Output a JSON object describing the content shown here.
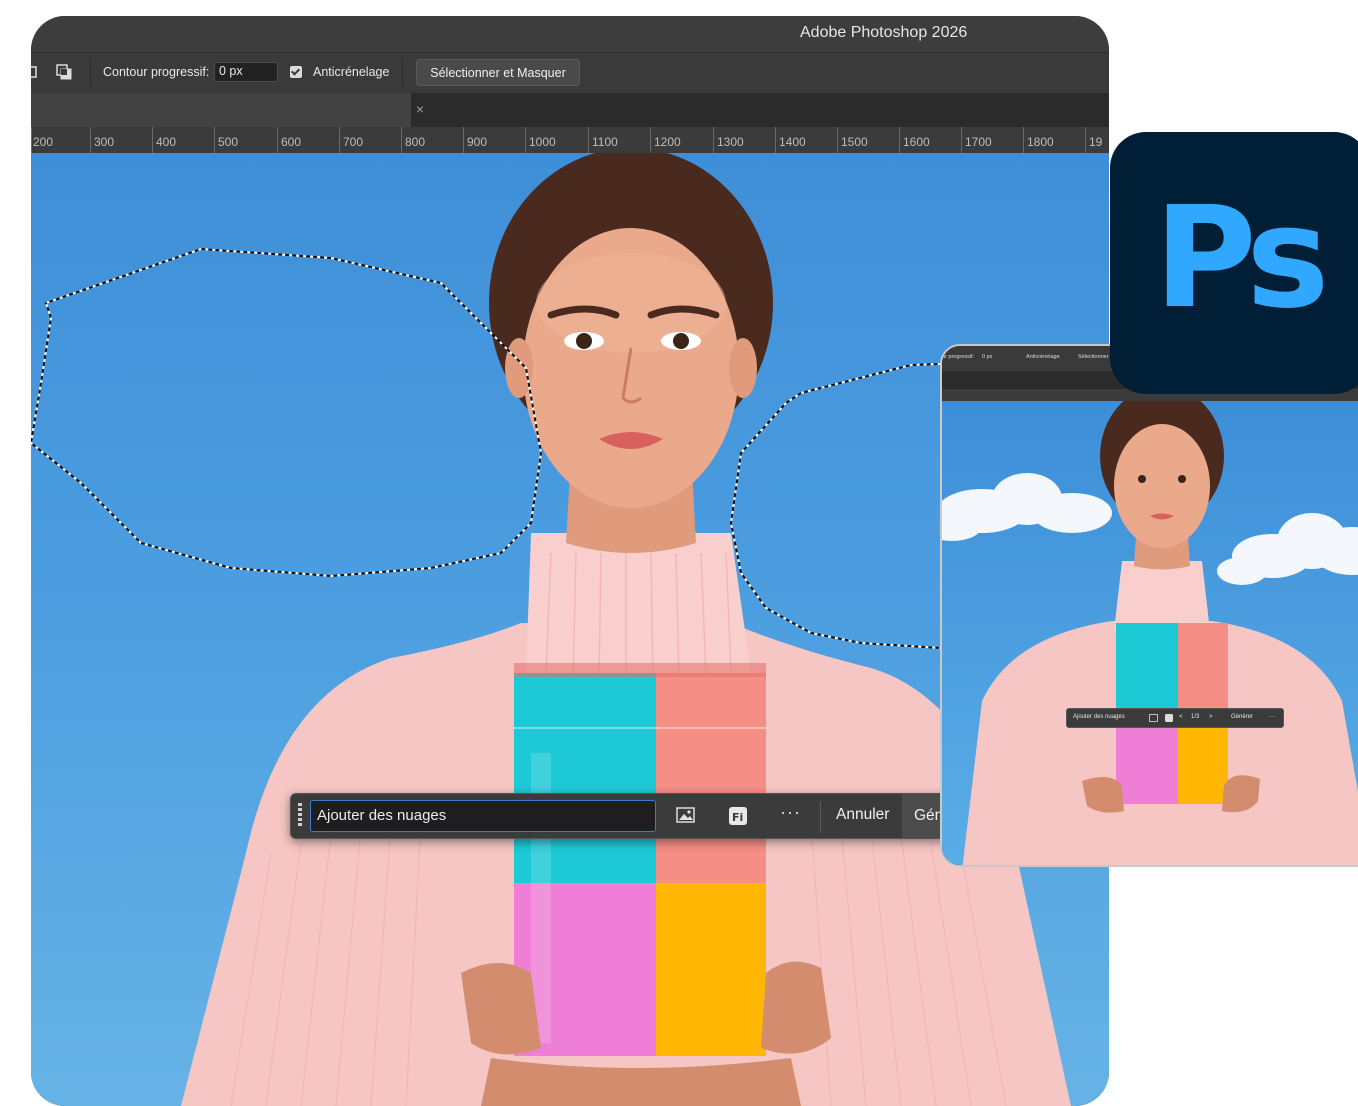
{
  "app": {
    "title": "Adobe Photoshop 2026"
  },
  "options_bar": {
    "feather_label": "Contour progressif:",
    "feather_value": "0 px",
    "antialias_label": "Anticrénelage",
    "antialias_checked": true,
    "select_mask_label": "Sélectionner et Masquer"
  },
  "tab": {
    "close_glyph": "×"
  },
  "ruler": {
    "ticks": [
      "200",
      "300",
      "400",
      "500",
      "600",
      "700",
      "800",
      "900",
      "1000",
      "1100",
      "1200",
      "1300",
      "1400",
      "1500",
      "1600",
      "1700",
      "1800",
      "19"
    ]
  },
  "taskbar": {
    "prompt_value": "Ajouter des nuages",
    "more_glyph": "···",
    "cancel_label": "Annuler",
    "generate_label": "Gén"
  },
  "preview": {
    "feather_label": "ur progressif:",
    "feather_value": "0 px",
    "antialias_label": "Anticrénelage",
    "select_mask_label": "Sélectionner e",
    "prompt_value": "Ajouter des nuages",
    "page_counter": "1/3",
    "generate_label": "Générer",
    "more_glyph": "···"
  },
  "logo": {
    "text": "Ps",
    "bg": "#001e36",
    "fg": "#31a8ff"
  },
  "colors": {
    "sky_top": "#3f8fd8",
    "sky_bottom": "#67b3e6",
    "sweater": "#f6c6c4",
    "bag_cyan": "#1ec9d6",
    "bag_coral": "#f58f86",
    "bag_pink": "#ef7fd6",
    "bag_yellow": "#ffb703"
  }
}
